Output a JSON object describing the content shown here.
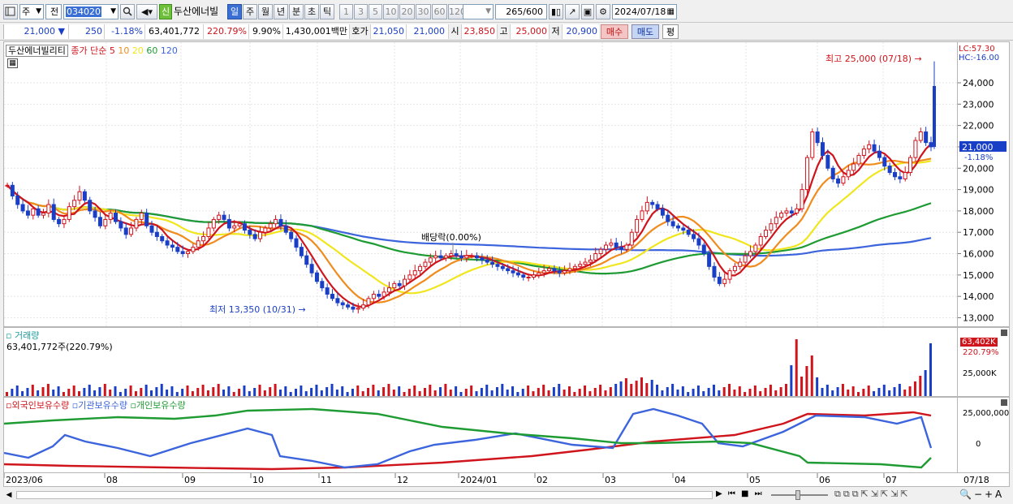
{
  "toolbar": {
    "period_type": "주",
    "stock_code": "034020",
    "stock_name": "두산에너빌",
    "credit_badge": "신",
    "period_buttons": [
      "일",
      "주",
      "월",
      "년",
      "분",
      "초",
      "틱"
    ],
    "interval_buttons": [
      "1",
      "3",
      "5",
      "10",
      "20",
      "30",
      "60",
      "120"
    ],
    "count_value": "265",
    "count_total": "/600",
    "date_value": "2024/07/18",
    "prev_label": "전"
  },
  "quote": {
    "price": "21,000",
    "change_arrow": "▼",
    "change": "250",
    "change_rate": "-1.18%",
    "volume": "63,401,772",
    "volume_rate": "220.79%",
    "turnover": "9.90%",
    "amount": "1,430,001백만",
    "bid_label": "호가",
    "bid": "21,050",
    "ask": "21,000",
    "open_label": "시",
    "open": "23,850",
    "high_label": "고",
    "high": "25,000",
    "low_label": "저",
    "low": "20,900",
    "buy_button": "매수",
    "sell_button": "매도",
    "avg_button": "평"
  },
  "price_panel": {
    "title": "두산에너빌리티",
    "ma_label": "종가 단순",
    "ma_periods": [
      "5",
      "10",
      "20",
      "60",
      "120"
    ],
    "ma_colors": [
      "#d0141c",
      "#f08c1e",
      "#f0e61e",
      "#1e9b32",
      "#3c64dc"
    ],
    "lc_label": "LC:57.30",
    "hc_label": "HC:-16.00",
    "current_price_label": "21,000",
    "current_rate_label": "-1.18%",
    "high_annotation": "최고 25,000 (07/18)",
    "low_annotation": "최저 13,350 (10/31)",
    "dividend_annotation": "배당락(0.00%)"
  },
  "volume_panel": {
    "title": "거래량",
    "value_label": "63,401,772주(220.79%)",
    "current_label": "63,402K",
    "current_rate": "220.79%",
    "axis_label": "25,000K"
  },
  "hold_panel": {
    "series_labels": [
      "외국인보유수량",
      "기관보유수량",
      "개인보유수량"
    ],
    "series_colors": [
      "#d0141c",
      "#3c64dc",
      "#1e9b32"
    ],
    "axis_labels": [
      "25,000,000",
      "0"
    ]
  },
  "xaxis": {
    "labels": [
      "2023/06",
      "08",
      "09",
      "10",
      "11",
      "12",
      "2024/01",
      "02",
      "03",
      "04",
      "05",
      "06",
      "07"
    ],
    "end_label": "07/18"
  },
  "chart_data": {
    "type": "candlestick",
    "y_ticks": [
      13000,
      14000,
      15000,
      16000,
      17000,
      18000,
      19000,
      20000,
      21000,
      22000,
      23000,
      24000
    ],
    "ylim": [
      12600,
      25900
    ],
    "period": [
      "2023/06",
      "2024/07/18"
    ],
    "last": {
      "date": "2024/07/18",
      "open": 23850,
      "high": 25000,
      "low": 20900,
      "close": 21000
    },
    "high_point": {
      "date": "07/18",
      "value": 25000
    },
    "low_point": {
      "date": "10/31",
      "value": 13350
    },
    "closes": [
      19200,
      18700,
      18300,
      18000,
      17800,
      18100,
      17800,
      17900,
      18300,
      17600,
      17400,
      17600,
      18200,
      18500,
      18900,
      18500,
      18000,
      17700,
      17300,
      17600,
      17900,
      17500,
      17200,
      16900,
      17200,
      17600,
      17900,
      17300,
      17000,
      16800,
      16600,
      16400,
      16300,
      16100,
      16000,
      16100,
      16300,
      16600,
      16800,
      17200,
      17600,
      17800,
      17600,
      17200,
      17300,
      17400,
      17100,
      16900,
      16700,
      17000,
      17200,
      17400,
      17600,
      17300,
      17000,
      16700,
      16300,
      15900,
      15500,
      15100,
      14700,
      14400,
      14100,
      13900,
      13700,
      13600,
      13500,
      13400,
      13450,
      13600,
      13900,
      14100,
      14000,
      14200,
      14400,
      14600,
      14500,
      14800,
      15000,
      15200,
      15400,
      15600,
      15800,
      15900,
      15800,
      15900,
      16000,
      15900,
      15800,
      15900,
      15900,
      15800,
      15700,
      15600,
      15500,
      15400,
      15300,
      15200,
      15100,
      15000,
      14900,
      14900,
      15000,
      15100,
      15200,
      15300,
      15200,
      15100,
      15200,
      15300,
      15400,
      15500,
      15600,
      15700,
      16000,
      16200,
      16400,
      16500,
      16300,
      16200,
      16400,
      17000,
      17600,
      18000,
      18400,
      18300,
      18100,
      17800,
      17500,
      17300,
      17200,
      17100,
      16900,
      16700,
      16400,
      16000,
      15400,
      14900,
      14600,
      14800,
      15200,
      15400,
      15600,
      15900,
      16100,
      16400,
      16800,
      17100,
      17400,
      17700,
      17900,
      18000,
      17900,
      18100,
      19000,
      20500,
      21700,
      21200,
      20600,
      20000,
      19500,
      19300,
      19600,
      19900,
      20200,
      20600,
      20900,
      21100,
      20800,
      20500,
      20100,
      19800,
      19600,
      19500,
      19800,
      20500,
      21300,
      21700,
      21200,
      21000
    ]
  }
}
